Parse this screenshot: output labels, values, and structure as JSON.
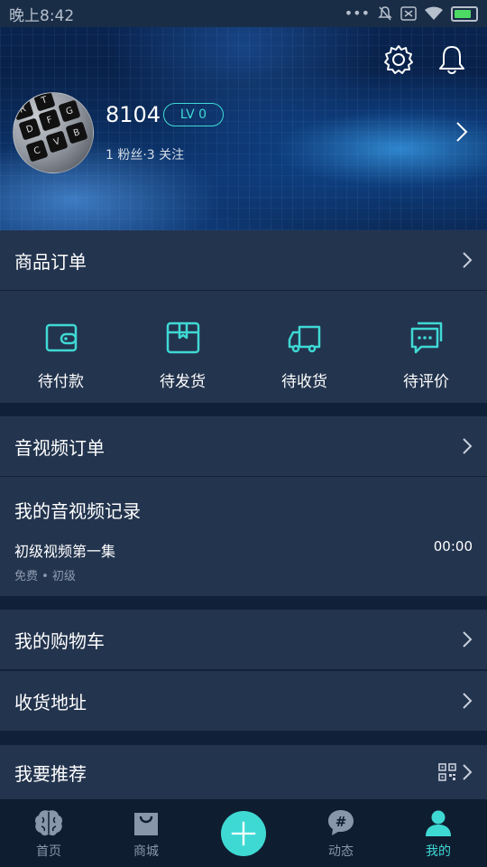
{
  "status_bar": {
    "time": "晚上8:42",
    "icons": [
      "more-dots-icon",
      "mute-bell-icon",
      "sim-icon",
      "wifi-icon",
      "battery-icon"
    ]
  },
  "profile": {
    "username": "8104",
    "level": "LV 0",
    "follow_text": "1 粉丝·3 关注",
    "accent_color": "#3fd9d4"
  },
  "product_orders": {
    "title": "商品订单",
    "items": [
      {
        "label": "待付款",
        "icon": "wallet-icon"
      },
      {
        "label": "待发货",
        "icon": "package-icon"
      },
      {
        "label": "待收货",
        "icon": "truck-icon"
      },
      {
        "label": "待评价",
        "icon": "chat-bubble-icon"
      }
    ]
  },
  "av_orders": {
    "title": "音视频订单"
  },
  "av_records": {
    "title": "我的音视频记录",
    "item_name": "初级视频第一集",
    "duration": "00:00",
    "meta": "免费 • 初级"
  },
  "cart": {
    "title": "我的购物车"
  },
  "address": {
    "title": "收货地址"
  },
  "recommend": {
    "title": "我要推荐"
  },
  "bottom_nav": {
    "items": [
      {
        "label": "首页",
        "icon": "brain-icon"
      },
      {
        "label": "商城",
        "icon": "shopping-bag-icon"
      },
      {
        "label": "",
        "icon": "plus-icon"
      },
      {
        "label": "动态",
        "icon": "hashtag-icon"
      },
      {
        "label": "我的",
        "icon": "user-icon"
      }
    ],
    "active_index": 4
  }
}
